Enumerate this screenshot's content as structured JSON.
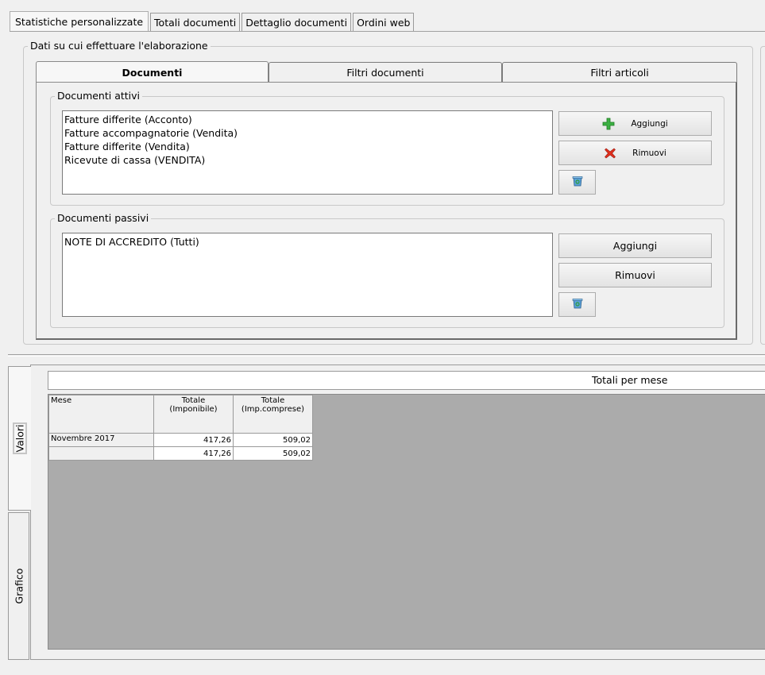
{
  "top_tabs": [
    {
      "label": "Statistiche personalizzate",
      "active": true
    },
    {
      "label": "Totali documenti",
      "active": false
    },
    {
      "label": "Dettaglio documenti",
      "active": false
    },
    {
      "label": "Ordini web",
      "active": false
    }
  ],
  "data_group": {
    "legend": "Dati su cui effettuare l'elaborazione",
    "tabs": [
      {
        "label": "Documenti",
        "active": true
      },
      {
        "label": "Filtri documenti",
        "active": false
      },
      {
        "label": "Filtri articoli",
        "active": false
      }
    ],
    "active_docs": {
      "legend": "Documenti attivi",
      "items": [
        "Fatture differite (Acconto)",
        "Fatture accompagnatorie (Vendita)",
        "Fatture differite (Vendita)",
        "Ricevute di cassa (VENDITA)"
      ],
      "add_label": "Aggiungi",
      "remove_label": "Rimuovi",
      "add_icon": "plus-icon",
      "remove_icon": "x-icon",
      "clear_icon": "recycle-bin-icon"
    },
    "passive_docs": {
      "legend": "Documenti passivi",
      "items": [
        "NOTE DI ACCREDITO (Tutti)"
      ],
      "add_label": "Aggiungi",
      "remove_label": "Rimuovi",
      "clear_icon": "recycle-bin-icon"
    }
  },
  "results": {
    "side_tabs": [
      {
        "label": "Valori",
        "active": true
      },
      {
        "label": "Grafico",
        "active": false
      }
    ],
    "title": "Totali per mese",
    "table": {
      "headers": [
        {
          "label": "Mese"
        },
        {
          "line1": "Totale",
          "line2": "(Imponibile)"
        },
        {
          "line1": "Totale",
          "line2": "(Imp.comprese)"
        }
      ],
      "rows": [
        [
          "Novembre 2017",
          "417,26",
          "509,02"
        ],
        [
          "",
          "417,26",
          "509,02"
        ]
      ]
    }
  },
  "colors": {
    "add_green": "#3cb043",
    "remove_red": "#e0301e",
    "grid_background": "#ababab"
  }
}
